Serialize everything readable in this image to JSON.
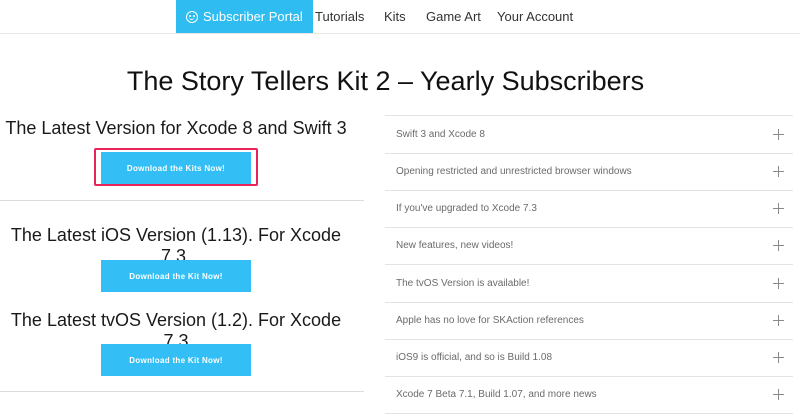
{
  "nav": {
    "items": [
      {
        "label": "Subscriber Portal",
        "icon": "smiley-icon",
        "active": true
      },
      {
        "label": "Tutorials"
      },
      {
        "label": "Kits"
      },
      {
        "label": "Game Art"
      },
      {
        "label": "Your Account"
      }
    ],
    "accent": "#2fbcf0"
  },
  "page": {
    "title": "The Story Tellers Kit 2 – Yearly Subscribers"
  },
  "versions": [
    {
      "title": "The Latest Version for Xcode 8 and Swift 3",
      "button": "Download the Kits Now!",
      "highlighted": true
    },
    {
      "title": "The Latest iOS Version (1.13). For Xcode 7.3.",
      "button": "Download the Kit Now!"
    },
    {
      "title": "The Latest tvOS Version (1.2). For Xcode 7.3",
      "button": "Download the Kit Now!"
    }
  ],
  "colors": {
    "button": "#33bff5",
    "highlight": "#e8245a"
  },
  "accordion": {
    "items": [
      "Swift 3 and Xcode 8",
      "Opening restricted and unrestricted browser windows",
      "If you've upgraded to Xcode 7.3",
      "New features, new videos!",
      "The tvOS Version is available!",
      "Apple has no love for SKAction references",
      "iOS9 is official, and so is Build 1.08",
      "Xcode 7 Beta 7.1, Build 1.07, and more news"
    ]
  }
}
